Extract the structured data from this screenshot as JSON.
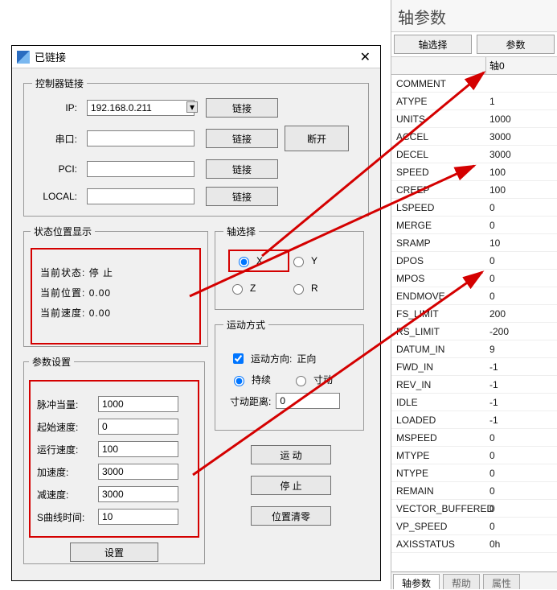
{
  "dialog": {
    "title": "已链接",
    "close_glyph": "✕",
    "controller_group": "控制器链接",
    "ip_label": "IP:",
    "ip_value": "192.168.0.211",
    "serial_label": "串口:",
    "serial_value": "",
    "pci_label": "PCI:",
    "pci_value": "",
    "local_label": "LOCAL:",
    "local_value": "",
    "connect_btn": "链接",
    "disconnect_btn": "断开",
    "status_group": "状态位置显示",
    "status_state_label": "当前状态:",
    "status_state_value": "停  止",
    "status_pos_label": "当前位置:",
    "status_pos_value": "0.00",
    "status_speed_label": "当前速度:",
    "status_speed_value": "0.00",
    "axis_sel_group": "轴选择",
    "axis_x": "X",
    "axis_y": "Y",
    "axis_z": "Z",
    "axis_r": "R",
    "motion_group": "运动方式",
    "motion_dir_label": "运动方向:",
    "motion_dir_value": "正向",
    "motion_continuous": "持续",
    "motion_jog": "寸动",
    "jog_dist_label": "寸动距离:",
    "jog_dist_value": "0",
    "param_group": "参数设置",
    "p_pulse_label": "脉冲当量:",
    "p_pulse_value": "1000",
    "p_startspd_label": "起始速度:",
    "p_startspd_value": "0",
    "p_runspd_label": "运行速度:",
    "p_runspd_value": "100",
    "p_accel_label": "加速度:",
    "p_accel_value": "3000",
    "p_decel_label": "减速度:",
    "p_decel_value": "3000",
    "p_scurve_label": "S曲线时间:",
    "p_scurve_value": "10",
    "set_btn": "设置",
    "run_btn": "运  动",
    "stop_btn": "停  止",
    "clear_btn": "位置清零"
  },
  "panel": {
    "title": "轴参数",
    "btn_axis_select": "轴选择",
    "btn_param": "参数",
    "col_header": "轴0",
    "rows": [
      {
        "name": "COMMENT",
        "value": ""
      },
      {
        "name": "ATYPE",
        "value": "1"
      },
      {
        "name": "UNITS",
        "value": "1000"
      },
      {
        "name": "ACCEL",
        "value": "3000"
      },
      {
        "name": "DECEL",
        "value": "3000"
      },
      {
        "name": "SPEED",
        "value": "100"
      },
      {
        "name": "CREEP",
        "value": "100"
      },
      {
        "name": "LSPEED",
        "value": "0"
      },
      {
        "name": "MERGE",
        "value": "0"
      },
      {
        "name": "SRAMP",
        "value": "10"
      },
      {
        "name": "DPOS",
        "value": "0"
      },
      {
        "name": "MPOS",
        "value": "0"
      },
      {
        "name": "ENDMOVE",
        "value": "0"
      },
      {
        "name": "FS_LIMIT",
        "value": "200"
      },
      {
        "name": "RS_LIMIT",
        "value": "-200"
      },
      {
        "name": "DATUM_IN",
        "value": "9"
      },
      {
        "name": "FWD_IN",
        "value": "-1"
      },
      {
        "name": "REV_IN",
        "value": "-1"
      },
      {
        "name": "IDLE",
        "value": "-1"
      },
      {
        "name": "LOADED",
        "value": "-1"
      },
      {
        "name": "MSPEED",
        "value": "0"
      },
      {
        "name": "MTYPE",
        "value": "0"
      },
      {
        "name": "NTYPE",
        "value": "0"
      },
      {
        "name": "REMAIN",
        "value": "0"
      },
      {
        "name": "VECTOR_BUFFERED",
        "value": "0"
      },
      {
        "name": "VP_SPEED",
        "value": "0"
      },
      {
        "name": "AXISSTATUS",
        "value": "0h"
      }
    ],
    "tab1": "轴参数",
    "tab2": "帮助",
    "tab3": "属性"
  }
}
